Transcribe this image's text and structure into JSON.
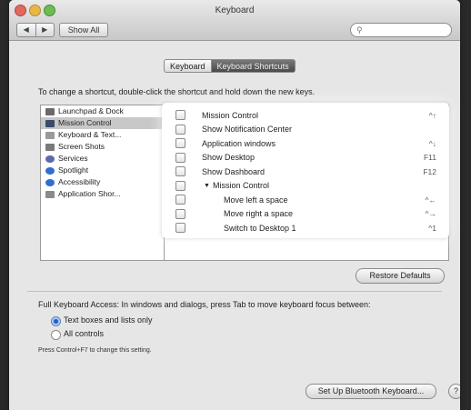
{
  "window": {
    "title": "Keyboard"
  },
  "toolbar": {
    "back_label": "◀",
    "forward_label": "▶",
    "show_all_label": "Show All",
    "search_placeholder": ""
  },
  "tabs": [
    {
      "label": "Keyboard"
    },
    {
      "label": "Keyboard Shortcuts"
    }
  ],
  "instructions": "To change a shortcut, double-click the shortcut and hold down the new keys.",
  "categories": [
    {
      "label": "Launchpad & Dock",
      "icon": "launchpad-icon",
      "color": "#6a6a6a",
      "selected": false
    },
    {
      "label": "Mission Control",
      "icon": "mission-control-icon",
      "color": "#3a4a6a",
      "selected": true
    },
    {
      "label": "Keyboard & Text...",
      "icon": "keyboard-icon",
      "color": "#9a9a9a",
      "selected": false
    },
    {
      "label": "Screen Shots",
      "icon": "screenshot-icon",
      "color": "#7a7a7a",
      "selected": false
    },
    {
      "label": "Services",
      "icon": "gear-icon",
      "color": "#5b6aa8",
      "selected": false
    },
    {
      "label": "Spotlight",
      "icon": "spotlight-icon",
      "color": "#2f6fd0",
      "selected": false
    },
    {
      "label": "Accessibility",
      "icon": "accessibility-icon",
      "color": "#2f6fd0",
      "selected": false
    },
    {
      "label": "Application Shor...",
      "icon": "app-shortcuts-icon",
      "color": "#8a8a8a",
      "selected": false
    }
  ],
  "shortcuts": [
    {
      "label": "Mission Control",
      "key": "^↑",
      "indent": 0,
      "disclosure": false
    },
    {
      "label": "Show Notification Center",
      "key": "",
      "indent": 0,
      "disclosure": false
    },
    {
      "label": "Application windows",
      "key": "^↓",
      "indent": 0,
      "disclosure": false
    },
    {
      "label": "Show Desktop",
      "key": "F11",
      "indent": 0,
      "disclosure": false
    },
    {
      "label": "Show Dashboard",
      "key": "F12",
      "indent": 0,
      "disclosure": false
    },
    {
      "label": "Mission Control",
      "key": "",
      "indent": 1,
      "disclosure": true
    },
    {
      "label": "Move left a space",
      "key": "^←",
      "indent": 2,
      "disclosure": false
    },
    {
      "label": "Move right a space",
      "key": "^→",
      "indent": 2,
      "disclosure": false
    },
    {
      "label": "Switch to Desktop 1",
      "key": "^1",
      "indent": 2,
      "disclosure": false
    }
  ],
  "restore_defaults_label": "Restore Defaults",
  "full_keyboard_access": {
    "label": "Full Keyboard Access: In windows and dialogs, press Tab to move keyboard focus between:",
    "options": [
      {
        "label": "Text boxes and lists only",
        "selected": true
      },
      {
        "label": "All controls",
        "selected": false
      }
    ],
    "note": "Press Control+F7 to change this setting."
  },
  "setup_bluetooth_label": "Set Up Bluetooth Keyboard...",
  "help_label": "?"
}
